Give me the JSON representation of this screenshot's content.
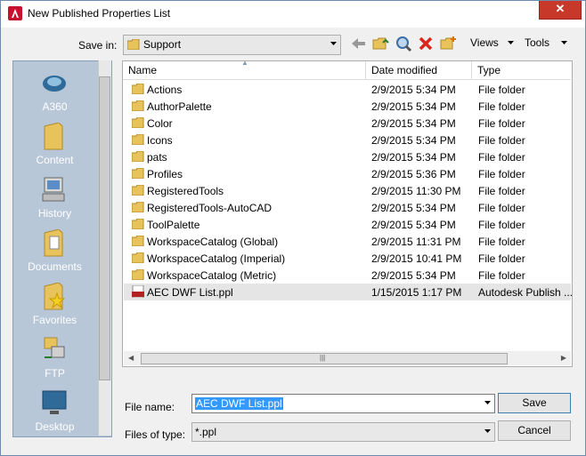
{
  "window": {
    "title": "New Published Properties List",
    "close_glyph": "✕"
  },
  "toolbar": {
    "save_in_label": "Save in:",
    "save_in_value": "Support",
    "views_label": "Views",
    "tools_label": "Tools",
    "icons": [
      "back-icon",
      "up-folder-icon",
      "search-web-icon",
      "delete-icon",
      "new-folder-icon"
    ]
  },
  "places": [
    {
      "label": "A360",
      "icon": "a360-icon"
    },
    {
      "label": "Content",
      "icon": "content-folder-icon"
    },
    {
      "label": "History",
      "icon": "history-icon"
    },
    {
      "label": "Documents",
      "icon": "documents-icon"
    },
    {
      "label": "Favorites",
      "icon": "favorites-icon"
    },
    {
      "label": "FTP",
      "icon": "ftp-icon"
    },
    {
      "label": "Desktop",
      "icon": "desktop-icon"
    }
  ],
  "columns": {
    "name": "Name",
    "date": "Date modified",
    "type": "Type"
  },
  "files": [
    {
      "name": "Actions",
      "date": "2/9/2015 5:34 PM",
      "type": "File folder",
      "kind": "folder"
    },
    {
      "name": "AuthorPalette",
      "date": "2/9/2015 5:34 PM",
      "type": "File folder",
      "kind": "folder"
    },
    {
      "name": "Color",
      "date": "2/9/2015 5:34 PM",
      "type": "File folder",
      "kind": "folder"
    },
    {
      "name": "Icons",
      "date": "2/9/2015 5:34 PM",
      "type": "File folder",
      "kind": "folder"
    },
    {
      "name": "pats",
      "date": "2/9/2015 5:34 PM",
      "type": "File folder",
      "kind": "folder"
    },
    {
      "name": "Profiles",
      "date": "2/9/2015 5:36 PM",
      "type": "File folder",
      "kind": "folder"
    },
    {
      "name": "RegisteredTools",
      "date": "2/9/2015 11:30 PM",
      "type": "File folder",
      "kind": "folder"
    },
    {
      "name": "RegisteredTools-AutoCAD",
      "date": "2/9/2015 5:34 PM",
      "type": "File folder",
      "kind": "folder"
    },
    {
      "name": "ToolPalette",
      "date": "2/9/2015 5:34 PM",
      "type": "File folder",
      "kind": "folder"
    },
    {
      "name": "WorkspaceCatalog (Global)",
      "date": "2/9/2015 11:31 PM",
      "type": "File folder",
      "kind": "folder"
    },
    {
      "name": "WorkspaceCatalog (Imperial)",
      "date": "2/9/2015 10:41 PM",
      "type": "File folder",
      "kind": "folder"
    },
    {
      "name": "WorkspaceCatalog (Metric)",
      "date": "2/9/2015 5:34 PM",
      "type": "File folder",
      "kind": "folder"
    },
    {
      "name": "AEC DWF List.ppl",
      "date": "1/15/2015 1:17 PM",
      "type": "Autodesk Publish ...",
      "kind": "ppl",
      "selected": true
    }
  ],
  "form": {
    "file_name_label": "File name:",
    "file_name_value": "AEC DWF List.ppl",
    "file_type_label": "Files of type:",
    "file_type_value": "*.ppl",
    "save_label": "Save",
    "cancel_label": "Cancel"
  },
  "colors": {
    "places_bg": "#b8c7d8",
    "close_red": "#c7382b",
    "selection_blue": "#3399ff",
    "folder_yellow": "#e8c25a"
  }
}
